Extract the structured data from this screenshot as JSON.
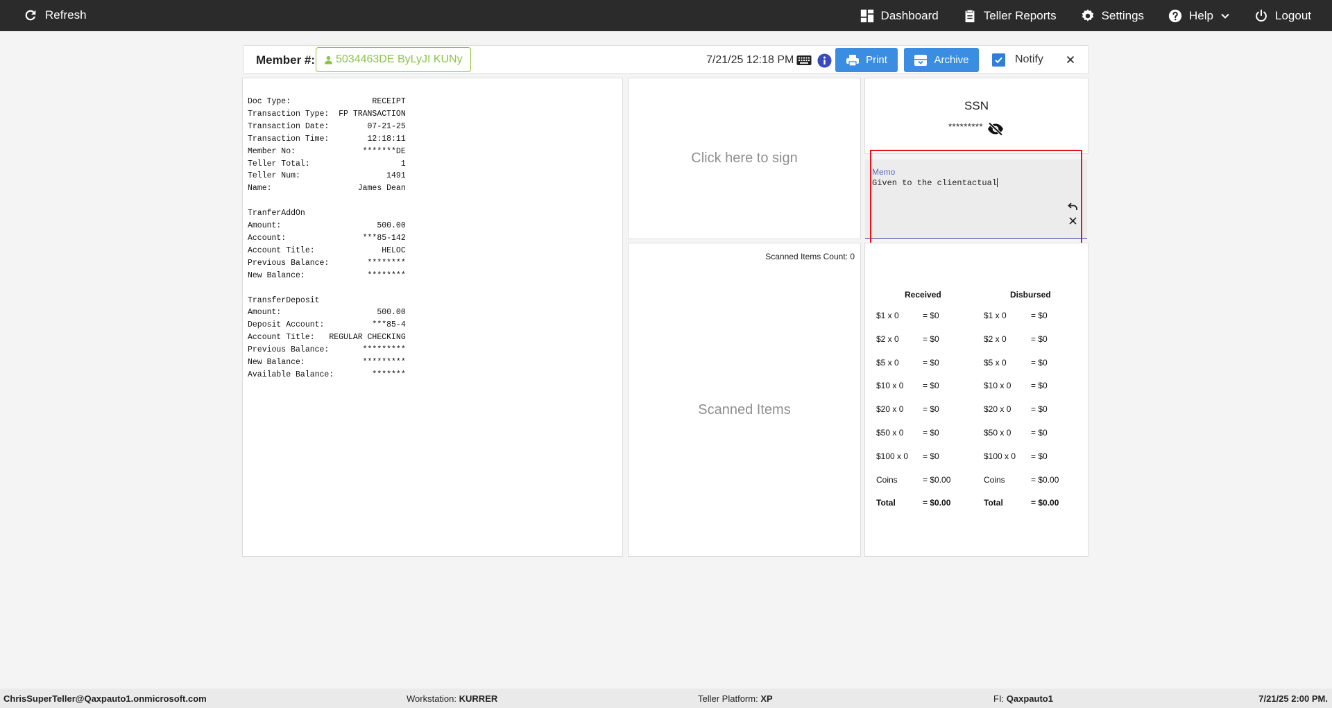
{
  "topbar": {
    "refresh_label": "Refresh",
    "dashboard_label": "Dashboard",
    "teller_reports_label": "Teller Reports",
    "settings_label": "Settings",
    "help_label": "Help",
    "logout_label": "Logout"
  },
  "member": {
    "label": "Member #:",
    "value": "5034463DE ByLyJI KUNy",
    "datetime": "7/21/25 12:18 PM",
    "print_label": "Print",
    "archive_label": "Archive",
    "notify_label": "Notify",
    "notify_checked": true
  },
  "receipt": {
    "sections": [
      [
        {
          "label": "Doc Type:",
          "value": "RECEIPT"
        },
        {
          "label": "Transaction Type:",
          "value": "FP TRANSACTION"
        },
        {
          "label": "Transaction Date:",
          "value": "07-21-25"
        },
        {
          "label": "Transaction Time:",
          "value": "12:18:11"
        },
        {
          "label": "Member No:",
          "value": "*******DE"
        },
        {
          "label": "Teller Total:",
          "value": "1"
        },
        {
          "label": "Teller Num:",
          "value": "1491"
        },
        {
          "label": "Name:",
          "value": "James Dean"
        }
      ],
      [
        {
          "label": "TranferAddOn",
          "value": ""
        },
        {
          "label": "Amount:",
          "value": "500.00"
        },
        {
          "label": "Account:",
          "value": "***85-142"
        },
        {
          "label": "Account Title:",
          "value": "HELOC"
        },
        {
          "label": "Previous Balance:",
          "value": "********"
        },
        {
          "label": "New Balance:",
          "value": "********"
        }
      ],
      [
        {
          "label": "TransferDeposit",
          "value": ""
        },
        {
          "label": "Amount:",
          "value": "500.00"
        },
        {
          "label": "Deposit Account:",
          "value": "***85-4"
        },
        {
          "label": "Account Title:",
          "value": "REGULAR CHECKING"
        },
        {
          "label": "Previous Balance:",
          "value": "*********"
        },
        {
          "label": "New Balance:",
          "value": "*********"
        },
        {
          "label": "Available Balance:",
          "value": "*******"
        }
      ]
    ]
  },
  "signature": {
    "prompt": "Click here to sign"
  },
  "ssn": {
    "label": "SSN",
    "masked_value": "*********"
  },
  "memo": {
    "label": "Memo",
    "value": "Given to the clientactual"
  },
  "scanned": {
    "count_label": "Scanned Items Count: 0",
    "title": "Scanned Items"
  },
  "cash": {
    "received_header": "Received",
    "disbursed_header": "Disbursed",
    "rows": [
      {
        "denom": "$1 x 0",
        "amount": "= $0"
      },
      {
        "denom": "$2 x 0",
        "amount": "= $0"
      },
      {
        "denom": "$5 x 0",
        "amount": "= $0"
      },
      {
        "denom": "$10 x 0",
        "amount": "= $0"
      },
      {
        "denom": "$20 x 0",
        "amount": "= $0"
      },
      {
        "denom": "$50 x 0",
        "amount": "= $0"
      },
      {
        "denom": "$100 x 0",
        "amount": "= $0"
      },
      {
        "denom": "Coins",
        "amount": "= $0.00"
      },
      {
        "denom": "Total",
        "amount": "= $0.00"
      }
    ],
    "disbursed_rows": [
      {
        "denom": "$1 x 0",
        "amount": "= $0"
      },
      {
        "denom": "$2 x 0",
        "amount": "= $0"
      },
      {
        "denom": "$5 x 0",
        "amount": "= $0"
      },
      {
        "denom": "$10 x 0",
        "amount": "= $0"
      },
      {
        "denom": "$20 x 0",
        "amount": "= $0"
      },
      {
        "denom": "$50 x 0",
        "amount": "= $0"
      },
      {
        "denom": "$100 x 0",
        "amount": "= $0"
      },
      {
        "denom": "Coins",
        "amount": "= $0.00"
      },
      {
        "denom": "Total",
        "amount": "= $0.00"
      }
    ]
  },
  "footer": {
    "user": "ChrisSuperTeller@Qaxpauto1.onmicrosoft.com",
    "workstation_label": "Workstation:",
    "workstation_value": "KURRER",
    "platform_label": "Teller Platform:",
    "platform_value": "XP",
    "fi_label": "FI:",
    "fi_value": "Qaxpauto1",
    "datetime": "7/21/25 2:00 PM."
  },
  "colors": {
    "topbar": "#2b2b2b",
    "button_blue": "#3a8de0",
    "member_green": "#8bc34a",
    "highlight_red": "#e8101a",
    "memo_label": "#5a6cc6"
  },
  "icons": [
    "refresh-icon",
    "dashboard-icon",
    "clipboard-icon",
    "gear-icon",
    "help-icon",
    "chevron-down-icon",
    "power-icon",
    "user-icon",
    "keyboard-icon",
    "info-icon",
    "printer-icon",
    "archive-icon",
    "check-icon",
    "close-icon",
    "eye-off-icon",
    "undo-icon"
  ]
}
